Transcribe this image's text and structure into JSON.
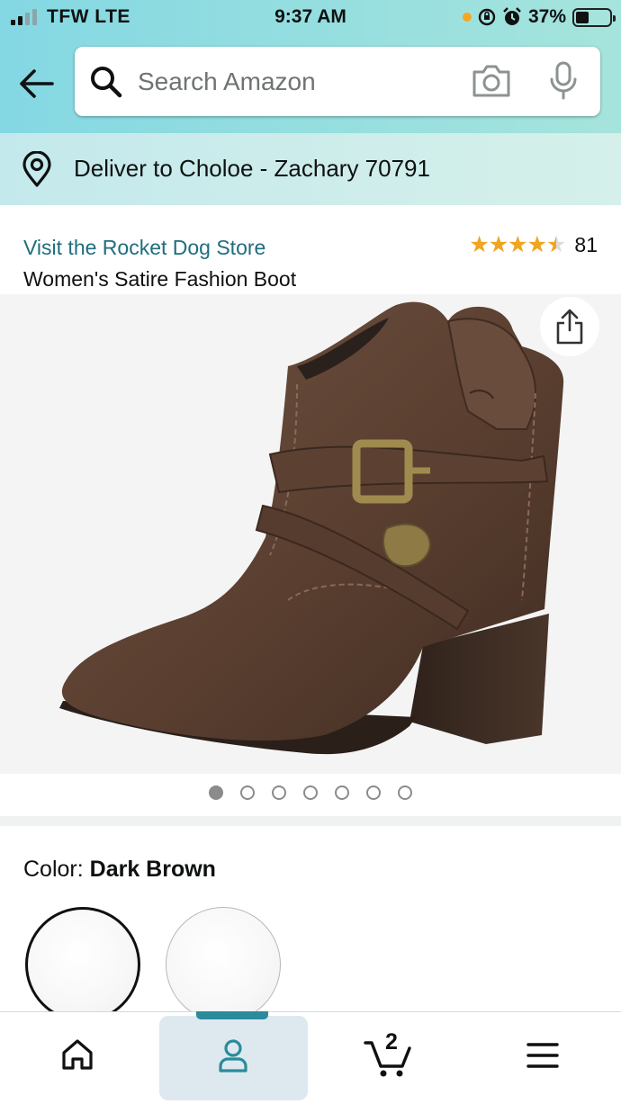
{
  "status_bar": {
    "carrier": "TFW  LTE",
    "time": "9:37 AM",
    "battery": "37%"
  },
  "search": {
    "placeholder": "Search Amazon"
  },
  "delivery": {
    "text": "Deliver to Choloe - Zachary 70791"
  },
  "product": {
    "store_link": "Visit the Rocket Dog Store",
    "title": "Women's Satire Fashion Boot",
    "rating": 4.5,
    "stars_glyphs": "★★★★★",
    "rating_count": "81",
    "image_count": 7,
    "active_image_index": 0
  },
  "color": {
    "label": "Color: ",
    "selected": "Dark Brown"
  },
  "bottom_nav": {
    "items": [
      {
        "name": "home",
        "icon": "home-icon"
      },
      {
        "name": "profile",
        "icon": "person-icon",
        "active": true
      },
      {
        "name": "cart",
        "icon": "cart-icon"
      },
      {
        "name": "menu",
        "icon": "hamburger-icon"
      }
    ],
    "cart_count": "2"
  },
  "colors": {
    "header_gradient_start": "#84d8e3",
    "header_gradient_end": "#a5e4dc",
    "link": "#1f6e7e",
    "star": "#f1a51c",
    "nav_accent": "#2a8b9b",
    "boot_leather": "#5e4333"
  }
}
